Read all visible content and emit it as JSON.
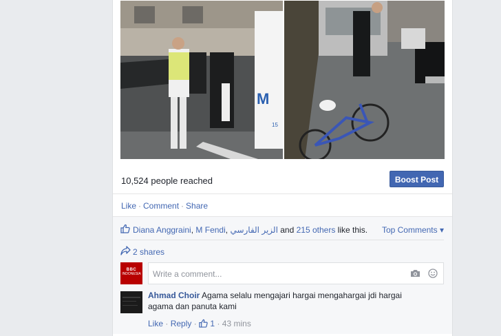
{
  "post": {
    "reach_text": "10,524 people reached",
    "boost_label": "Boost Post",
    "actions": {
      "like": "Like",
      "comment": "Comment",
      "share": "Share",
      "separator": "·"
    },
    "ambulance_letter": "M",
    "ambulance_number": "15"
  },
  "feedback": {
    "likers": [
      "Diana Anggraini",
      "M Fendi",
      "الزير الفارسي"
    ],
    "likers_sep1": ", ",
    "likers_sep2": ", ",
    "and_text": " and ",
    "others_link": "215 others",
    "like_suffix": " like this.",
    "top_comments": "Top Comments ▾",
    "shares": "2 shares"
  },
  "composer": {
    "placeholder": "Write a comment...",
    "avatar_logo": "BBC",
    "avatar_caption": "INDONESIA",
    "icons": [
      "camera-icon",
      "smile-icon"
    ]
  },
  "comment": {
    "author": "Ahmad Choir",
    "text": "Agama selalu mengajari hargai mengahargai jdi hargai agama dan panuta kami",
    "like": "Like",
    "reply": "Reply",
    "likes_count": "1",
    "time": "43 mins",
    "separator": "·"
  },
  "colors": {
    "brand_blue": "#4267b2",
    "link_blue": "#365899",
    "background": "#e9ebee",
    "bbc_red": "#b80000"
  }
}
